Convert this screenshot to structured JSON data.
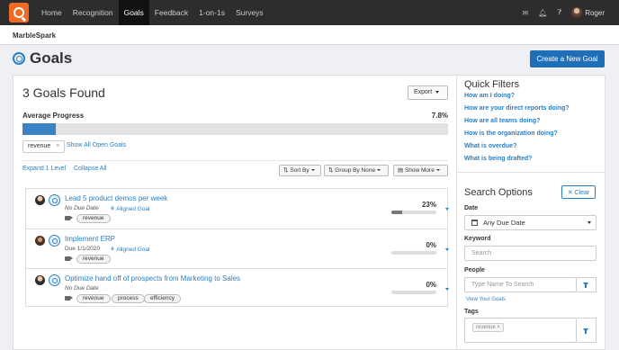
{
  "nav": {
    "items": [
      {
        "label": "Home",
        "active": false
      },
      {
        "label": "Recognition",
        "active": false
      },
      {
        "label": "Goals",
        "active": true
      },
      {
        "label": "Feedback",
        "active": false
      },
      {
        "label": "1-on-1s",
        "active": false
      },
      {
        "label": "Surveys",
        "active": false
      }
    ],
    "user_name": "Roger"
  },
  "org": {
    "name": "MarbleSpark"
  },
  "header": {
    "title": "Goals",
    "create_button": "Create a New Goal"
  },
  "summary": {
    "count_label": "3 Goals Found",
    "export_label": "Export"
  },
  "progress": {
    "label": "Average Progress",
    "value_label": "7.8%",
    "value": 7.8
  },
  "filter": {
    "tag": "revenue",
    "remove_symbol": "×",
    "show_all": "Show All Open Goals"
  },
  "toolbar": {
    "expand": "Expand 1 Level",
    "collapse": "Collapse All",
    "sort": "Sort By",
    "group": "Group By None",
    "show_more": "Show More"
  },
  "goals": [
    {
      "title": "Lead 5 product demos per week",
      "due": "No Due Date",
      "aligned": "Aligned Goal",
      "percent_label": "23%",
      "percent": 23,
      "tags": [
        "revenue"
      ]
    },
    {
      "title": "Implement ERP",
      "due": "Due 1/1/2020",
      "aligned": "Aligned Goal",
      "percent_label": "0%",
      "percent": 0,
      "tags": [
        "revenue"
      ]
    },
    {
      "title": "Optimize hand off of prospects from Marketing to Sales",
      "due": "No Due Date",
      "aligned": "",
      "percent_label": "0%",
      "percent": 0,
      "tags": [
        "revenue",
        "process",
        "efficiency"
      ]
    }
  ],
  "quick_filters": {
    "title": "Quick Filters",
    "links": [
      "How am I doing?",
      "How are your direct reports doing?",
      "How are all teams doing?",
      "How is the organization doing?",
      "What is overdue?",
      "What is being drafted?"
    ]
  },
  "search": {
    "title": "Search Options",
    "clear": "Clear",
    "date_label": "Date",
    "date_value": "Any Due Date",
    "keyword_label": "Keyword",
    "keyword_placeholder": "Search",
    "people_label": "People",
    "people_placeholder": "Type Name To Search",
    "view_your_goals": "View Your Goals",
    "tags_label": "Tags",
    "tag_value": "revenue",
    "tag_remove": "×"
  },
  "colors": {
    "accent": "#2a7fc1",
    "brand": "#f06a24",
    "nav_bg": "#2d2d2d",
    "primary_button": "#1f6fb8"
  },
  "icons": {
    "envelope": "envelope-icon",
    "bell": "bell-icon",
    "help": "help-icon",
    "calendar": "calendar-icon",
    "filter": "filter-icon",
    "tag": "tag-icon"
  }
}
